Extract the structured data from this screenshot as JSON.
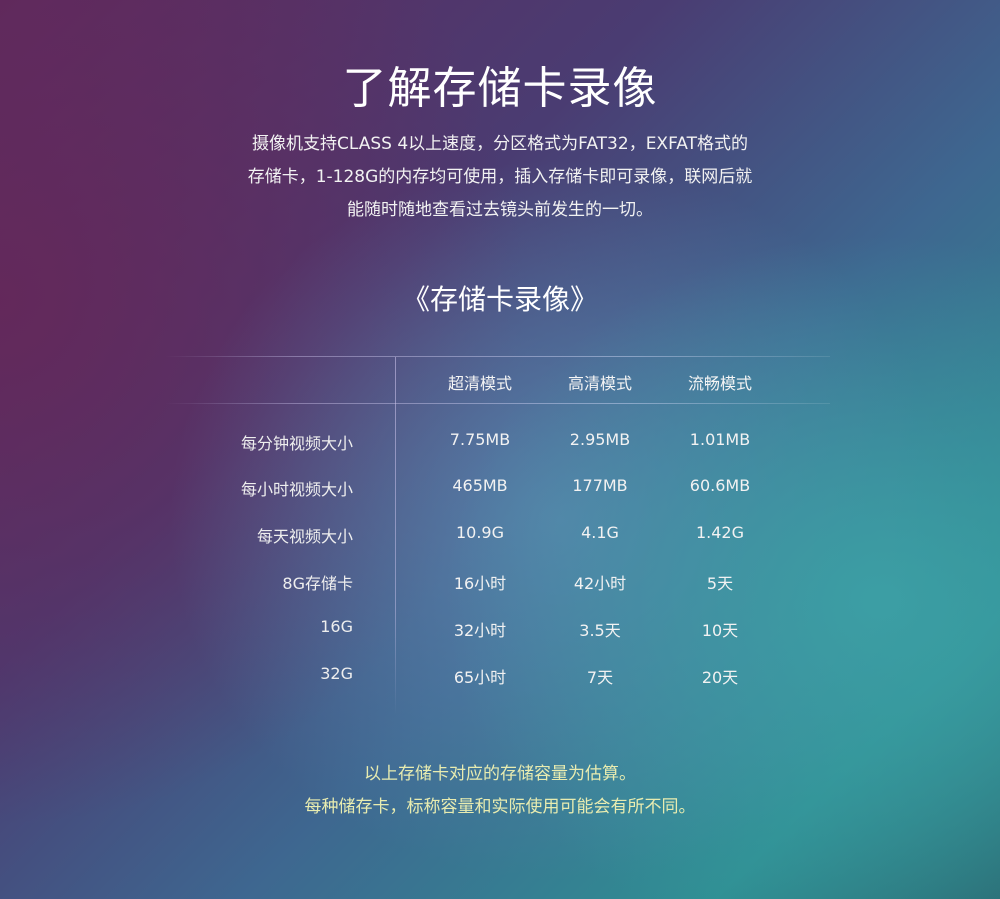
{
  "title": "了解存储卡录像",
  "description": [
    "摄像机支持CLASS 4以上速度，分区格式为FAT32，EXFAT格式的",
    "存储卡，1-128G的内存均可使用，插入存储卡即可录像，联网后就",
    "能随时随地查看过去镜头前发生的一切。"
  ],
  "subtitle": "《存储卡录像》",
  "table": {
    "headers": [
      "超清模式",
      "高清模式",
      "流畅模式"
    ],
    "rows": [
      {
        "label": "每分钟视频大小",
        "values": [
          "7.75MB",
          "2.95MB",
          "1.01MB"
        ]
      },
      {
        "label": "每小时视频大小",
        "values": [
          "465MB",
          "177MB",
          "60.6MB"
        ]
      },
      {
        "label": "每天视频大小",
        "values": [
          "10.9G",
          "4.1G",
          "1.42G"
        ]
      },
      {
        "label": "8G存储卡",
        "values": [
          "16小时",
          "42小时",
          "5天"
        ]
      },
      {
        "label": "16G",
        "values": [
          "32小时",
          "3.5天",
          "10天"
        ]
      },
      {
        "label": "32G",
        "values": [
          "65小时",
          "7天",
          "20天"
        ]
      }
    ]
  },
  "notes": [
    "以上存储卡对应的存储容量为估算。",
    "每种储存卡，标称容量和实际使用可能会有所不同。"
  ],
  "colors": {
    "note_text": "#e8ecb0",
    "background_left": "#5e2a5e",
    "background_right": "#2f8f93"
  }
}
